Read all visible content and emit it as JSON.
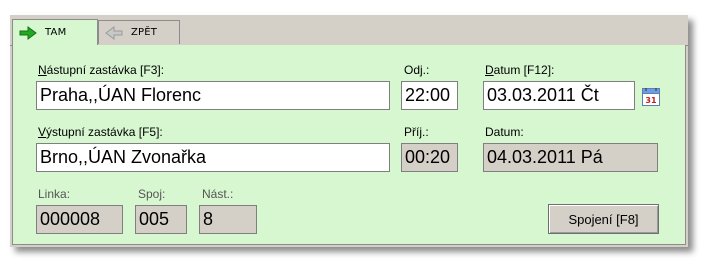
{
  "tabs": [
    {
      "label": "TAM",
      "icon": "arrow-right-icon",
      "active": true
    },
    {
      "label": "ZPĚT",
      "icon": "arrow-left-icon",
      "active": false
    }
  ],
  "boarding": {
    "stop_label_first": "N",
    "stop_label_rest": "ástupní zastávka [F3]:",
    "stop_value": "Praha,,ÚAN Florenc",
    "departure_label": "Odj.:",
    "departure_value": "22:00",
    "date_label_first": "D",
    "date_label_rest": "atum [F12]:",
    "date_value": "03.03.2011 Čt",
    "calendar_day": "31"
  },
  "alighting": {
    "stop_label_first": "V",
    "stop_label_rest": "ýstupní zastávka [F5]:",
    "stop_value": "Brno,,ÚAN Zvonařka",
    "arrival_label": "Příj.:",
    "arrival_value": "00:20",
    "date_label": "Datum:",
    "date_value": "04.03.2011 Pá"
  },
  "details": {
    "line_label": "Linka:",
    "line_value": "000008",
    "connection_label": "Spoj:",
    "connection_value": "005",
    "platform_label": "Nást.:",
    "platform_value": "8"
  },
  "connections_button": "Spojení [F8]",
  "colors": {
    "panel_bg": "#d7f7d1",
    "window_bg": "#d4d0c8",
    "readonly_bg": "#d4d0c8",
    "arrow_active": "#22a822",
    "arrow_inactive": "#b8b8b8"
  }
}
